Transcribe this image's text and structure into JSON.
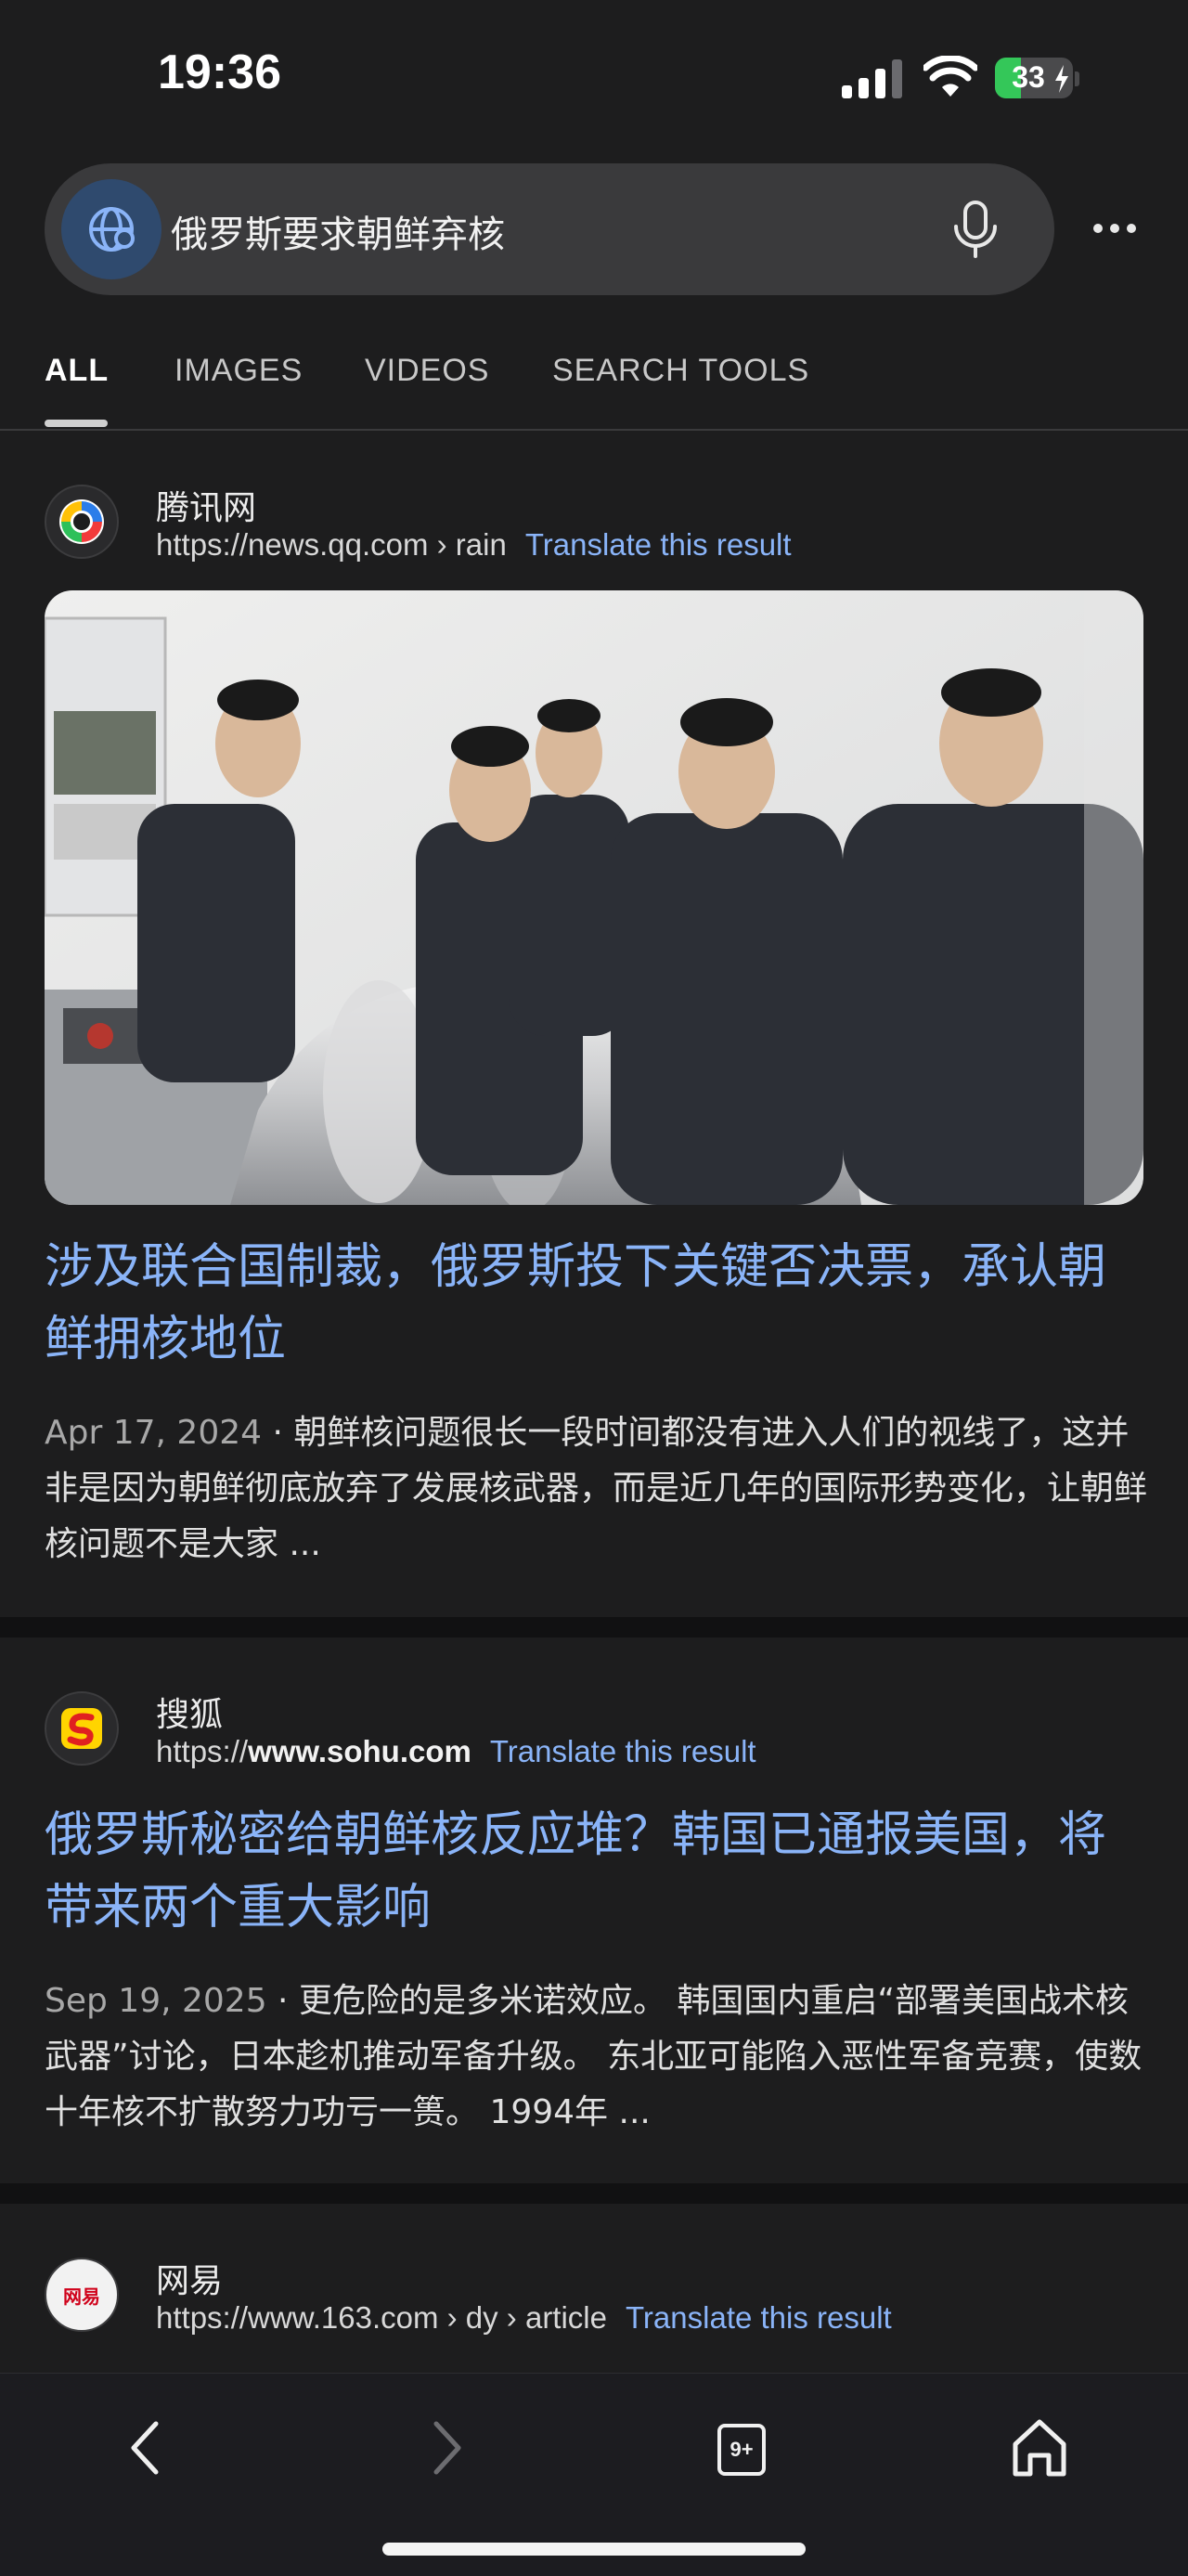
{
  "status_bar": {
    "time": "19:36",
    "battery_pct": "33",
    "battery_level": 0.33
  },
  "search": {
    "query": "俄罗斯要求朝鲜弃核",
    "globe_icon": "globe-icon",
    "mic_icon": "microphone-icon",
    "more_icon": "more-horizontal-icon"
  },
  "tabs": [
    {
      "label": "ALL",
      "active": true
    },
    {
      "label": "IMAGES",
      "active": false
    },
    {
      "label": "VIDEOS",
      "active": false
    },
    {
      "label": "SEARCH TOOLS",
      "active": false
    }
  ],
  "results": [
    {
      "site": "腾讯网",
      "url_plain": "https://news.qq.com › rain",
      "translate": "Translate this result",
      "title": "涉及联合国制裁，俄罗斯投下关键否决票，承认朝鲜拥核地位",
      "date": "Apr 17, 2024",
      "snippet": "朝鲜核问题很长一段时间都没有进入人们的视线了，这并非是因为朝鲜彻底放弃了发展核武器，而是近几年的国际形势变化，让朝鲜核问题不是大家 ..."
    },
    {
      "site": "搜狐",
      "url_prefix": "https://",
      "url_bold": "www.sohu.com",
      "translate": "Translate this result",
      "title": "俄罗斯秘密给朝鲜核反应堆？韩国已通报美国，将带来两个重大影响",
      "date": "Sep 19, 2025",
      "snippet": "更危险的是多米诺效应。 韩国国内重启“部署美国战术核武器”讨论，日本趁机推动军备升级。 东北亚可能陷入恶性军备竞赛，使数十年核不扩散努力功亏一篑。 1994年 ..."
    },
    {
      "site": "网易",
      "url_plain": "https://www.163.com › dy › article",
      "translate": "Translate this result",
      "favicon_text": "网易"
    }
  ],
  "separator": " · ",
  "bottom_bar": {
    "tabs_count": "9+",
    "icons": [
      "back-icon",
      "forward-icon",
      "tabs-icon",
      "home-icon"
    ]
  },
  "colors": {
    "link": "#8ab4f8",
    "background": "#1d1d1e",
    "battery": "#34c759"
  }
}
